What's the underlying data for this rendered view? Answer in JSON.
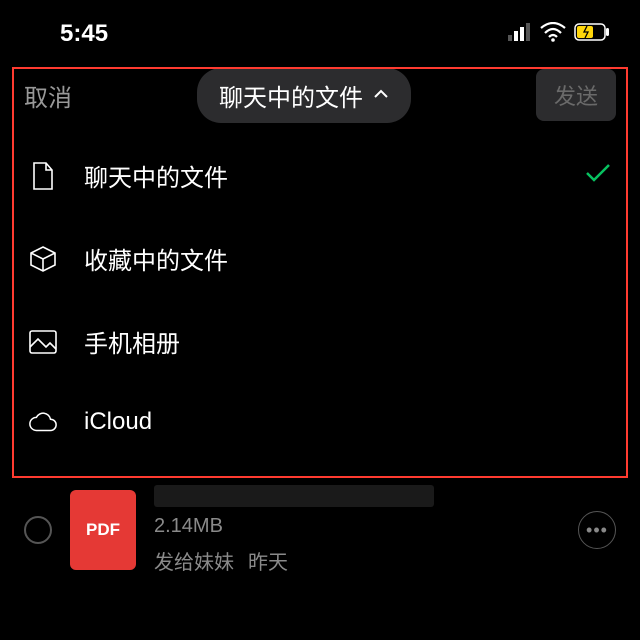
{
  "status": {
    "time": "5:45"
  },
  "nav": {
    "cancel": "取消",
    "title": "聊天中的文件",
    "send": "发送"
  },
  "dropdown": {
    "items": [
      {
        "label": "聊天中的文件",
        "icon": "file-icon",
        "selected": true
      },
      {
        "label": "收藏中的文件",
        "icon": "cube-icon",
        "selected": false
      },
      {
        "label": "手机相册",
        "icon": "photo-icon",
        "selected": false
      },
      {
        "label": "iCloud",
        "icon": "cloud-icon",
        "selected": false
      }
    ]
  },
  "file": {
    "badge": "PDF",
    "size": "2.14MB",
    "meta_to": "发给妹妹",
    "meta_when": "昨天"
  }
}
